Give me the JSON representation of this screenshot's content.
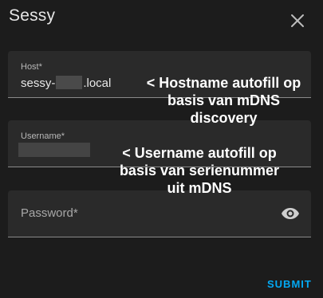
{
  "dialog": {
    "title": "Sessy",
    "close_icon": "close-icon"
  },
  "fields": {
    "host": {
      "label": "Host*",
      "value_prefix": "sessy-",
      "value_suffix": ".local"
    },
    "username": {
      "label": "Username*"
    },
    "password": {
      "label": "Password*",
      "toggle_icon": "eye-icon"
    }
  },
  "annotations": {
    "host": [
      "< Hostname autofill op",
      "basis van mDNS",
      "discovery"
    ],
    "username": [
      "< Username autofill op",
      "basis van serienummer",
      "uit mDNS"
    ]
  },
  "actions": {
    "submit_label": "SUBMIT"
  },
  "colors": {
    "background": "#1c1c1c",
    "field_background": "#2a2a2a",
    "accent": "#03a9f4"
  }
}
